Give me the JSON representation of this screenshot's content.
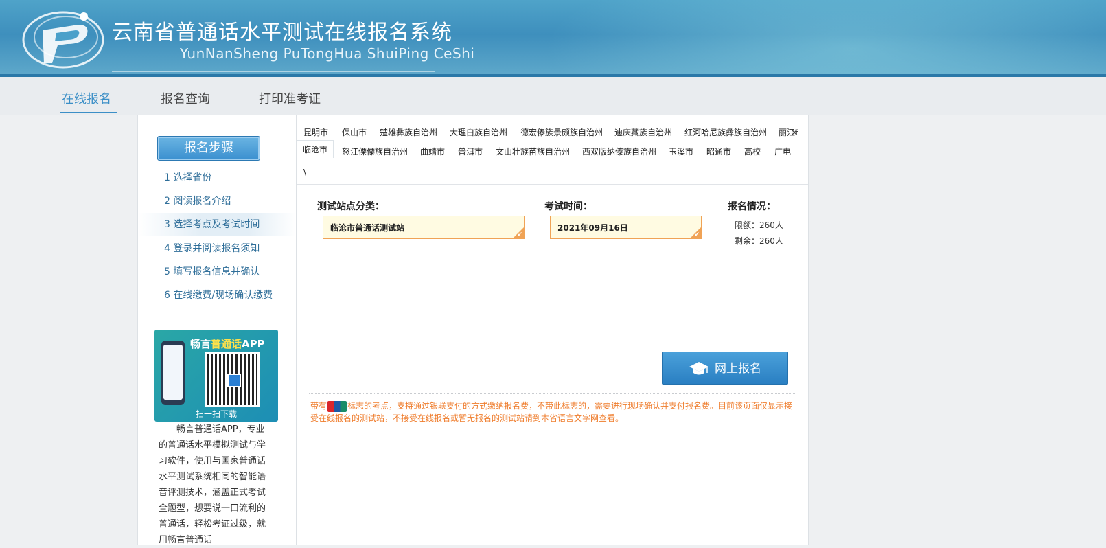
{
  "header": {
    "title": "云南省普通话水平测试在线报名系统",
    "subtitle": "YunNanSheng PuTongHua ShuiPing CeShi"
  },
  "nav": {
    "items": [
      {
        "label": "在线报名"
      },
      {
        "label": "报名查询"
      },
      {
        "label": "打印准考证"
      }
    ]
  },
  "sidebar": {
    "steps_title": "报名步骤",
    "steps": [
      {
        "label": "1 选择省份"
      },
      {
        "label": "2 阅读报名介绍"
      },
      {
        "label": "3 选择考点及考试时间"
      },
      {
        "label": "4 登录并阅读报名须知"
      },
      {
        "label": "5 填写报名信息并确认"
      },
      {
        "label": "6 在线缴费/现场确认缴费"
      }
    ],
    "app": {
      "title_a": "畅言",
      "title_b": "普通话",
      "title_c": "APP",
      "scan": "扫一扫下载",
      "description": "畅言普通话APP，专业的普通话水平模拟测试与学习软件，使用与国家普通话水平测试系统相同的智能语音评测技术，涵盖正式考试全题型，想要说一口流利的普通话，轻松考证过级，就用畅言普通话"
    }
  },
  "main": {
    "city_row1": [
      "昆明市",
      "保山市",
      "楚雄彝族自治州",
      "大理白族自治州",
      "德宏傣族景颇族自治州",
      "迪庆藏族自治州",
      "红河哈尼族彝族自治州",
      "丽江市"
    ],
    "city_row2": [
      "临沧市",
      "怒江傈僳族自治州",
      "曲靖市",
      "普洱市",
      "文山壮族苗族自治州",
      "西双版纳傣族自治州",
      "玉溪市",
      "昭通市",
      "高校",
      "广电"
    ],
    "city_extra": "\\",
    "site_label": "测试站点分类：",
    "site_value": "临沧市普通话测试站",
    "time_label": "考试时间：",
    "time_value": "2021年09月16日",
    "status_label": "报名情况：",
    "quota": "限额：260人",
    "remaining": "剩余：260人",
    "apply_button": "网上报名",
    "notice_a": "带有",
    "notice_b": "标志的考点，支持通过银联支付的方式缴纳报名费，不带此标志的，需要进行现场确认并支付报名费。目前该页面仅显示接受在线报名的测试站，不接受在线报名或暂无报名的测试站请到本省语言文字网查看。"
  },
  "colors": {
    "accent": "#3b8fc7",
    "notice": "#ef7d2d",
    "select_border": "#f0a356"
  }
}
